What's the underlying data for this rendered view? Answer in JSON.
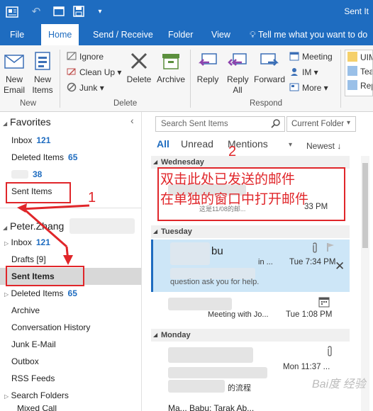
{
  "titlebar": {
    "title": "Sent It"
  },
  "tabs": [
    "File",
    "Home",
    "Send / Receive",
    "Folder",
    "View"
  ],
  "tell_me": "Tell me what you want to do",
  "ribbon": {
    "new_email": "New Email",
    "new_items": "New Items",
    "ignore": "Ignore",
    "clean_up": "Clean Up",
    "junk": "Junk",
    "delete": "Delete",
    "archive": "Archive",
    "reply": "Reply",
    "reply_all": "Reply All",
    "forward": "Forward",
    "meeting": "Meeting",
    "im": "IM",
    "more": "More",
    "partial_1": "UIM",
    "partial_2": "Tea",
    "partial_3": "Rep",
    "group_new": "New",
    "group_delete": "Delete",
    "group_respond": "Respond"
  },
  "folders": {
    "favorites": "Favorites",
    "fav_inbox": "Inbox",
    "fav_inbox_count": "121",
    "fav_deleted": "Deleted Items",
    "fav_deleted_count": "65",
    "fav_unknown_count": "38",
    "fav_sent": "Sent Items",
    "account": "Peter.Zhang",
    "inbox": "Inbox",
    "inbox_count": "121",
    "drafts": "Drafts [9]",
    "sent": "Sent Items",
    "deleted": "Deleted Items",
    "deleted_count": "65",
    "archive": "Archive",
    "conversation_history": "Conversation History",
    "junk": "Junk E-Mail",
    "outbox": "Outbox",
    "rss": "RSS Feeds",
    "search_folders": "Search Folders",
    "partial_bottom": "Mixed Call"
  },
  "msglist": {
    "search_placeholder": "Search Sent Items",
    "scope": "Current Folder",
    "filter_all": "All",
    "filter_unread": "Unread",
    "filter_mentions": "Mentions",
    "sort": "Newest",
    "group_wednesday": "Wednesday",
    "wed_time": "33 PM",
    "wed_partial": "这是11/08的邮...",
    "group_tuesday": "Tuesday",
    "tue1_sender": "bu",
    "tue1_preview_top": "in ...",
    "tue1_time": "Tue 7:34 PM",
    "tue1_preview": "question ask you for help.",
    "tue2_subject": "Meeting with Jo...",
    "tue2_time": "Tue 1:08 PM",
    "group_monday": "Monday",
    "mon_time": "Mon 11:37 ...",
    "mon_preview": "的流程",
    "mon_partial": "Ma... Babu; Tarak Ab..."
  },
  "annotations": {
    "num1": "1",
    "num2": "2",
    "note_line1": "双击此处已发送的邮件",
    "note_line2": "在单独的窗口中打开邮件"
  },
  "watermark": "Bai度 经验",
  "colors": {
    "accent": "#1e6cc0",
    "annotation": "#e0262a",
    "selection": "#cde6f7"
  }
}
